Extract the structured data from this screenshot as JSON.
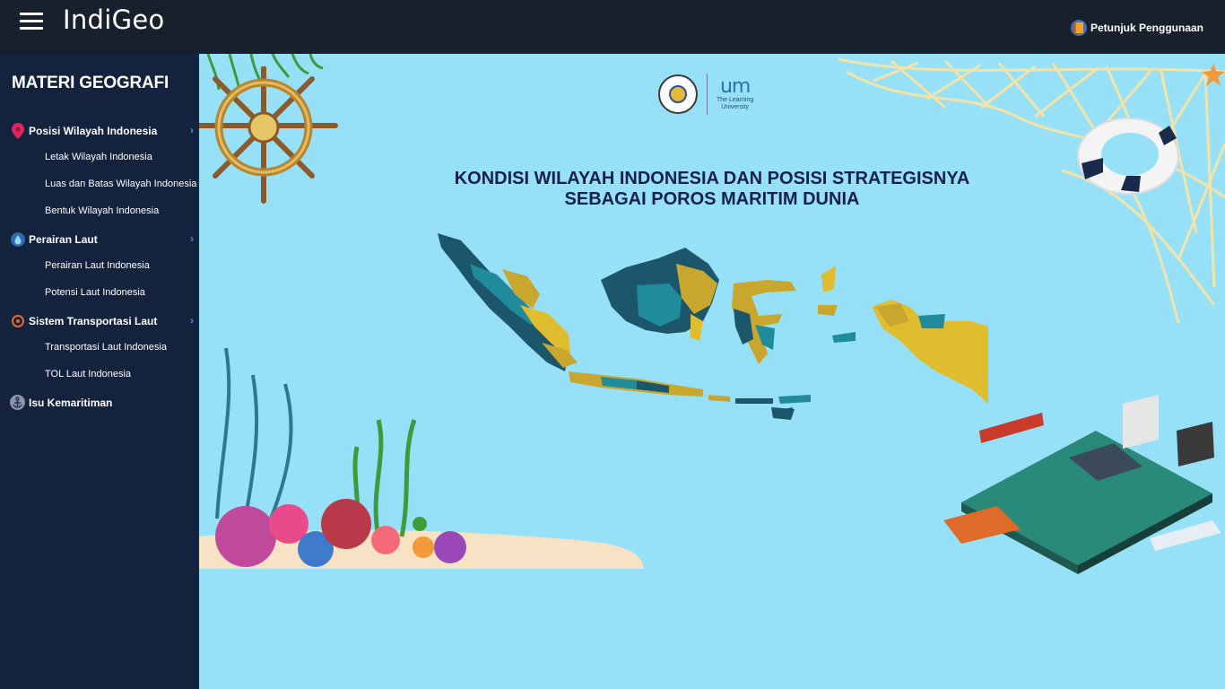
{
  "header": {
    "brand": "IndiGeo",
    "guide_label": "Petunjuk Penggunaan"
  },
  "sidebar": {
    "title": "MATERI GEOGRAFI",
    "sections": [
      {
        "label": "Posisi Wilayah Indonesia",
        "icon": "map-pin-icon",
        "items": [
          "Letak Wilayah Indonesia",
          "Luas dan Batas Wilayah Indonesia",
          "Bentuk Wilayah Indonesia"
        ]
      },
      {
        "label": "Perairan Laut",
        "icon": "water-drop-icon",
        "items": [
          "Perairan Laut Indonesia",
          "Potensi Laut Indonesia"
        ]
      },
      {
        "label": "Sistem Transportasi Laut",
        "icon": "compass-icon",
        "items": [
          "Transportasi Laut Indonesia",
          "TOL Laut Indonesia"
        ]
      },
      {
        "label": "Isu Kemaritiman",
        "icon": "anchor-icon",
        "items": []
      }
    ]
  },
  "main": {
    "title_line1": "KONDISI WILAYAH INDONESIA DAN POSISI STRATEGISNYA",
    "title_line2": "SEBAGAI POROS MARITIM DUNIA",
    "logo_mark": "um",
    "logo_sub1": "The Learning",
    "logo_sub2": "University",
    "colors": {
      "teal": "#1f8b9b",
      "dark_teal": "#1c566a",
      "gold": "#c9a72e",
      "sea": "#97e1f8"
    }
  }
}
